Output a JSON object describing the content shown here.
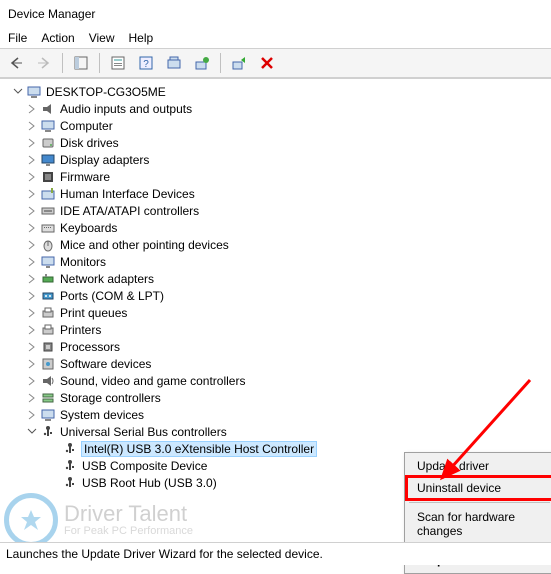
{
  "window": {
    "title": "Device Manager"
  },
  "menu": {
    "file": "File",
    "action": "Action",
    "view": "View",
    "help": "Help"
  },
  "status_text": "Launches the Update Driver Wizard for the selected device.",
  "root": {
    "name": "DESKTOP-CG3O5ME"
  },
  "categories": [
    {
      "label": "Audio inputs and outputs",
      "icon": "audio"
    },
    {
      "label": "Computer",
      "icon": "computer"
    },
    {
      "label": "Disk drives",
      "icon": "disk"
    },
    {
      "label": "Display adapters",
      "icon": "display"
    },
    {
      "label": "Firmware",
      "icon": "firmware"
    },
    {
      "label": "Human Interface Devices",
      "icon": "hid"
    },
    {
      "label": "IDE ATA/ATAPI controllers",
      "icon": "ide"
    },
    {
      "label": "Keyboards",
      "icon": "keyboard"
    },
    {
      "label": "Mice and other pointing devices",
      "icon": "mouse"
    },
    {
      "label": "Monitors",
      "icon": "monitor"
    },
    {
      "label": "Network adapters",
      "icon": "network"
    },
    {
      "label": "Ports (COM & LPT)",
      "icon": "ports"
    },
    {
      "label": "Print queues",
      "icon": "printq"
    },
    {
      "label": "Printers",
      "icon": "printer"
    },
    {
      "label": "Processors",
      "icon": "cpu"
    },
    {
      "label": "Software devices",
      "icon": "software"
    },
    {
      "label": "Sound, video and game controllers",
      "icon": "sound"
    },
    {
      "label": "Storage controllers",
      "icon": "storage"
    },
    {
      "label": "System devices",
      "icon": "system"
    }
  ],
  "usb": {
    "label": "Universal Serial Bus controllers",
    "children": [
      {
        "label": "Intel(R) USB 3.0 eXtensible Host Controller",
        "selected": true
      },
      {
        "label": "USB Composite Device"
      },
      {
        "label": "USB Root Hub (USB 3.0)"
      }
    ]
  },
  "context_menu": {
    "update": "Update driver",
    "uninstall": "Uninstall device",
    "scan": "Scan for hardware changes",
    "properties": "Properties"
  },
  "watermark": {
    "title": "Driver Talent",
    "subtitle": "For Peak PC Performance"
  }
}
